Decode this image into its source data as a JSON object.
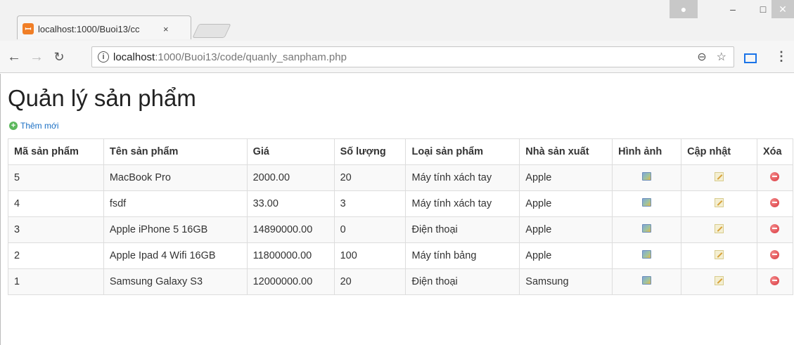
{
  "browser": {
    "tab_title": "localhost:1000/Buoi13/cc",
    "tab_close": "×",
    "url_host": "localhost",
    "url_rest": ":1000/Buoi13/code/quanly_sanpham.php",
    "info_glyph": "i"
  },
  "page": {
    "title": "Quản lý sản phẩm",
    "add_label": "Thêm mới"
  },
  "table": {
    "headers": [
      "Mã sản phẩm",
      "Tên sản phẩm",
      "Giá",
      "Số lượng",
      "Loại sản phẩm",
      "Nhà sản xuất",
      "Hình ảnh",
      "Cập nhật",
      "Xóa"
    ],
    "rows": [
      {
        "id": "5",
        "name": "MacBook Pro",
        "price": "2000.00",
        "qty": "20",
        "type": "Máy tính xách tay",
        "maker": "Apple"
      },
      {
        "id": "4",
        "name": "fsdf",
        "price": "33.00",
        "qty": "3",
        "type": "Máy tính xách tay",
        "maker": "Apple"
      },
      {
        "id": "3",
        "name": "Apple iPhone 5 16GB",
        "price": "14890000.00",
        "qty": "0",
        "type": "Điện thoại",
        "maker": "Apple"
      },
      {
        "id": "2",
        "name": "Apple Ipad 4 Wifi 16GB",
        "price": "11800000.00",
        "qty": "100",
        "type": "Máy tính bảng",
        "maker": "Apple"
      },
      {
        "id": "1",
        "name": "Samsung Galaxy S3",
        "price": "12000000.00",
        "qty": "20",
        "type": "Điện thoại",
        "maker": "Samsung"
      }
    ]
  }
}
